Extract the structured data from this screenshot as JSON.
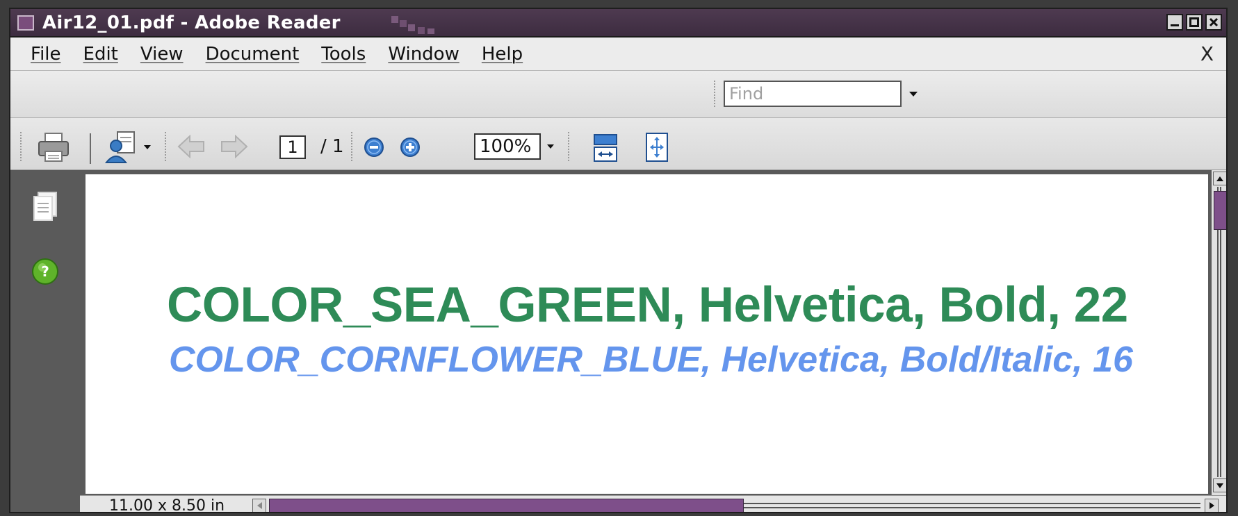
{
  "window": {
    "title": "Air12_01.pdf - Adobe Reader"
  },
  "menu": {
    "items": [
      {
        "label": "File"
      },
      {
        "label": "Edit"
      },
      {
        "label": "View"
      },
      {
        "label": "Document"
      },
      {
        "label": "Tools"
      },
      {
        "label": "Window"
      },
      {
        "label": "Help"
      }
    ],
    "close_label": "X"
  },
  "find": {
    "placeholder": "Find"
  },
  "toolbar": {
    "current_page": "1",
    "page_total": "/ 1",
    "zoom": "100%"
  },
  "document": {
    "line1": "COLOR_SEA_GREEN, Helvetica, Bold, 22",
    "line2": "COLOR_CORNFLOWER_BLUE, Helvetica, Bold/Italic, 16",
    "line1_color": "#2e8b57",
    "line2_color": "#6495ed"
  },
  "status": {
    "page_size": "11.00 x 8.50 in"
  },
  "scroll": {
    "horizontal_fraction": 0.51,
    "vertical_fraction": 0.14
  },
  "colors": {
    "accent": "#7e4f8a",
    "titlebar": "#4e3a50"
  },
  "icons": {
    "print": "printer-icon",
    "collaborate": "collaborate-icon",
    "prev": "arrow-left-icon",
    "next": "arrow-right-icon",
    "zoom_out": "zoom-out-icon",
    "zoom_in": "zoom-in-icon",
    "fit_width": "fit-width-icon",
    "fit_page": "fit-page-icon",
    "pages": "pages-icon",
    "help": "help-icon"
  }
}
